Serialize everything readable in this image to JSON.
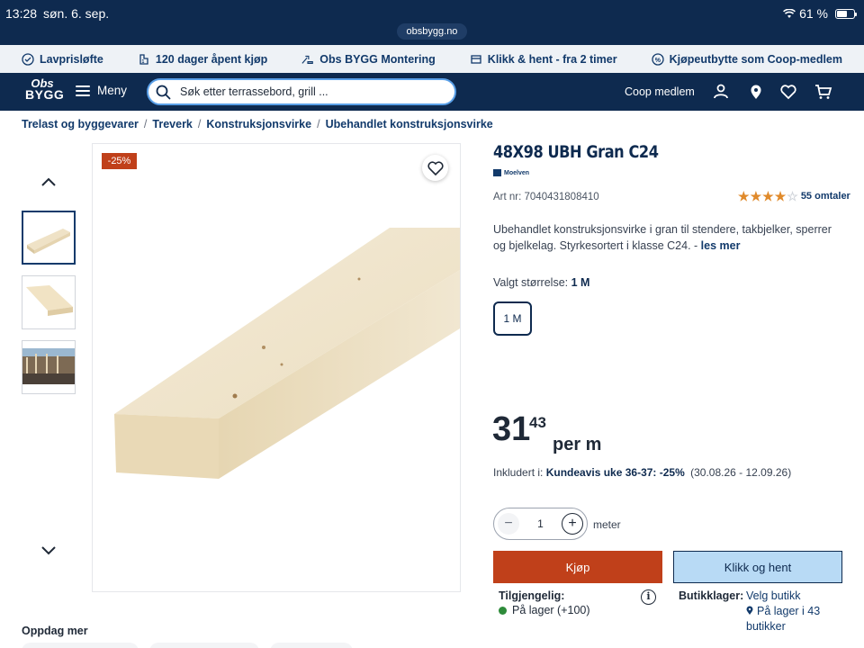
{
  "status_bar": {
    "time": "13:28",
    "date": "søn. 6. sep.",
    "battery_pct": "61 %",
    "battery_level": 0.61,
    "url": "obsbygg.no"
  },
  "usp": [
    {
      "icon": "check-circle-icon",
      "label": "Lavprisløfte"
    },
    {
      "icon": "return-icon",
      "label": "120 dager åpent kjøp"
    },
    {
      "icon": "tools-icon",
      "label": "Obs BYGG Montering"
    },
    {
      "icon": "store-icon",
      "label": "Klikk & hent - fra 2 timer"
    },
    {
      "icon": "coop-percent-icon",
      "label": "Kjøpeutbytte som Coop-medlem"
    }
  ],
  "header": {
    "logo_line1": "Obs",
    "logo_line2": "BYGG",
    "menu_label": "Meny",
    "search_placeholder": "Søk etter terrassebord, grill ...",
    "coop_label": "Coop medlem"
  },
  "breadcrumb": [
    "Trelast og byggevarer",
    "Treverk",
    "Konstruksjonsvirke",
    "Ubehandlet konstruksjonsvirke"
  ],
  "gallery": {
    "discount_badge": "-25%",
    "thumbnail_count": 3
  },
  "product": {
    "title": "48X98 UBH Gran C24",
    "brand": "Moelven",
    "art_nr": "Art nr: 7040431808410",
    "rating": 4,
    "rating_count": "55 omtaler",
    "description": "Ubehandlet konstruksjonsvirke i gran til stendere, takbjelker, sperrer og bjelkelag. Styrkesortert i klasse C24. -",
    "read_more": "les mer",
    "size_label": "Valgt størrelse:",
    "size_value": "1 M",
    "size_option": "1 M",
    "price_int": "31",
    "price_dec": "43",
    "price_unit": "per m",
    "campaign_prefix": "Inkludert i:",
    "campaign_name": "Kundeavis uke 36-37: -25%",
    "campaign_dates": "(30.08.26 - 12.09.26)",
    "qty_value": "1",
    "qty_unit": "meter",
    "buy_label": "Kjøp",
    "collect_label": "Klikk og hent",
    "availability_title": "Tilgjengelig:",
    "availability_status": "På lager (+100)",
    "stores_title": "Butikklager:",
    "choose_store": "Velg butikk",
    "stores_stock": "På lager i 43 butikker"
  },
  "discover_title": "Oppdag mer",
  "colors": {
    "navy": "#0e2a4f",
    "buy": "#c0401a",
    "collect": "#b8daf5",
    "in_stock": "#2e8b3a",
    "star": "#e08a2b"
  }
}
